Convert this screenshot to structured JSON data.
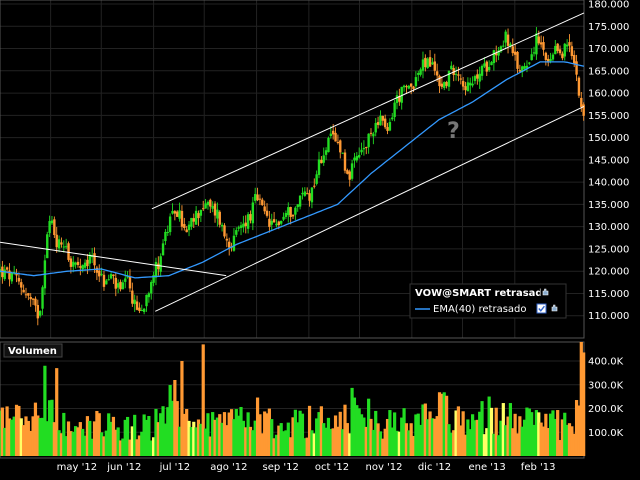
{
  "colors": {
    "up": "#22dd22",
    "down": "#ff9933",
    "neutral": "#ffff66",
    "ema": "#3399ff",
    "channel": "#ffffff",
    "grid": "#222222",
    "panel_border": "#555555",
    "question": "#777777"
  },
  "legend": {
    "title": "VOW@SMART retrasado",
    "ema_label": "EMA(40) retrasado",
    "hand_icon": "hand-icon",
    "checkbox_icon": "checkbox-icon"
  },
  "volume_panel": {
    "title": "Volumen"
  },
  "chart_data": [
    {
      "type": "candlestick",
      "title": "",
      "xlabel": "",
      "ylabel": "",
      "ylim": [
        105,
        180
      ],
      "yticks": [
        "110.000",
        "115.000",
        "120.000",
        "125.000",
        "130.000",
        "135.000",
        "140.000",
        "145.000",
        "150.000",
        "155.000",
        "160.000",
        "165.000",
        "170.000",
        "175.000",
        "180.000"
      ],
      "ytick_values": [
        110,
        115,
        120,
        125,
        130,
        135,
        140,
        145,
        150,
        155,
        160,
        165,
        170,
        175,
        180
      ],
      "xticks": [
        "may '12",
        "jun '12",
        "jul '12",
        "ago '12",
        "sep '12",
        "oct '12",
        "nov '12",
        "dic '12",
        "ene '13",
        "feb '13"
      ],
      "xtick_days": [
        30,
        60,
        91,
        121,
        152,
        183,
        213,
        244,
        274,
        305
      ],
      "x_range_days": [
        0,
        346
      ],
      "x_origin": "2012-04-01",
      "close_key_days": [
        0,
        5,
        10,
        14,
        17,
        20,
        23,
        25,
        27,
        30,
        34,
        39,
        41,
        45,
        50,
        54,
        58,
        62,
        66,
        71,
        75,
        80,
        84,
        87,
        90,
        94,
        97,
        100,
        104,
        107,
        110,
        114,
        117,
        121,
        125,
        129,
        133,
        138,
        141,
        145,
        149,
        152,
        156,
        161,
        165,
        170,
        175,
        180,
        184,
        188,
        193,
        197,
        202,
        206,
        210,
        213,
        217,
        221,
        225,
        229,
        234,
        238,
        242,
        246,
        250,
        254,
        258,
        262,
        266,
        270,
        275,
        279,
        283,
        288,
        292,
        296,
        300,
        304,
        308,
        312,
        315,
        318,
        321,
        324,
        327,
        330,
        333,
        336,
        339,
        342,
        344,
        346
      ],
      "close_key_values": [
        120,
        119,
        118,
        116,
        114,
        112,
        110,
        116,
        126,
        132,
        126,
        127,
        122,
        121,
        120,
        124,
        120,
        117,
        119,
        115,
        118,
        112,
        111,
        115,
        119,
        122,
        127,
        130,
        134,
        132,
        128,
        131,
        133,
        135,
        134,
        133,
        128,
        126,
        129,
        131,
        133,
        137,
        133,
        130,
        131,
        133,
        134,
        138,
        137,
        143,
        148,
        150,
        148,
        141,
        144,
        146,
        148,
        152,
        155,
        150,
        158,
        160,
        161,
        163,
        166,
        167,
        165,
        161,
        164,
        166,
        162,
        161,
        164,
        166,
        169,
        170,
        173,
        168,
        165,
        167,
        169,
        172,
        170,
        166,
        167,
        170,
        169,
        171,
        168,
        164,
        158,
        155
      ],
      "ema": {
        "name": "EMA(40) retrasado",
        "key_days": [
          0,
          20,
          40,
          60,
          80,
          100,
          120,
          140,
          160,
          180,
          200,
          220,
          240,
          260,
          280,
          300,
          320,
          335,
          346
        ],
        "key_values": [
          120,
          119,
          120,
          120.5,
          118.5,
          119,
          122,
          126,
          129,
          132,
          135,
          142,
          148,
          154,
          158,
          163,
          167,
          167,
          166
        ]
      },
      "trendlines": [
        {
          "name": "channel-upper",
          "p1": [
            90,
            134
          ],
          "p2": [
            346,
            178
          ]
        },
        {
          "name": "channel-lower",
          "p1": [
            92,
            111
          ],
          "p2": [
            346,
            157
          ]
        },
        {
          "name": "downtrend",
          "p1": [
            0,
            126.5
          ],
          "p2": [
            134,
            119
          ]
        }
      ]
    },
    {
      "type": "bar",
      "title": "Volumen",
      "ylim": [
        0,
        480
      ],
      "yticks": [
        "100.0K",
        "200.0K",
        "300.0K",
        "400.0K"
      ],
      "ytick_values": [
        100,
        200,
        300,
        400
      ],
      "unit": "K",
      "key_days": [
        0,
        10,
        20,
        30,
        40,
        50,
        60,
        70,
        80,
        90,
        100,
        110,
        120,
        130,
        140,
        150,
        160,
        170,
        180,
        190,
        200,
        210,
        220,
        230,
        240,
        250,
        260,
        270,
        280,
        290,
        300,
        310,
        320,
        330,
        340,
        346
      ],
      "key_values": [
        180,
        200,
        160,
        230,
        150,
        140,
        170,
        130,
        150,
        140,
        260,
        150,
        160,
        140,
        150,
        200,
        170,
        150,
        160,
        200,
        170,
        220,
        180,
        150,
        160,
        170,
        210,
        190,
        160,
        200,
        180,
        150,
        160,
        150,
        120,
        480
      ],
      "spikes": [
        {
          "day": 26,
          "value": 380
        },
        {
          "day": 33,
          "value": 370
        },
        {
          "day": 103,
          "value": 320
        },
        {
          "day": 108,
          "value": 400
        },
        {
          "day": 121,
          "value": 470
        },
        {
          "day": 345,
          "value": 480
        }
      ]
    }
  ]
}
